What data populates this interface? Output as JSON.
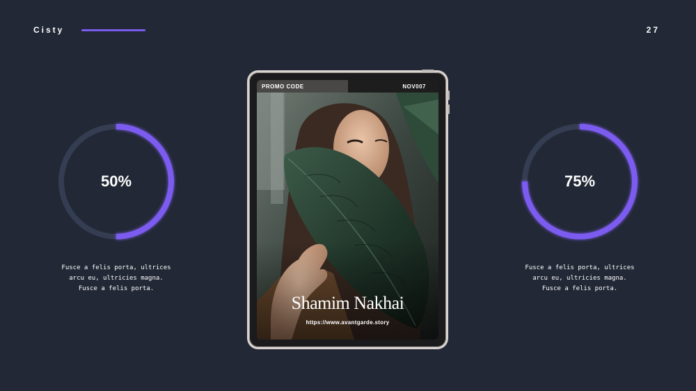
{
  "header": {
    "brand": "Cisty",
    "page_number": "27"
  },
  "colors": {
    "background": "#222835",
    "accent": "#7b5cf0",
    "ring_track": "#343d51"
  },
  "stats": [
    {
      "percent": 50,
      "label": "50%",
      "caption": "Fusce a felis porta, ultrices arcu eu, ultricies magna. Fusce a felis porta."
    },
    {
      "percent": 75,
      "label": "75%",
      "caption": "Fusce a felis porta, ultrices arcu eu, ultricies magna. Fusce a felis porta."
    }
  ],
  "tablet": {
    "promo_label": "PROMO CODE",
    "promo_code": "NOV007",
    "name": "Shamim Nakhai",
    "url": "https://www.avantgarde.story",
    "image_icon": "woman-with-leaf-photo"
  }
}
